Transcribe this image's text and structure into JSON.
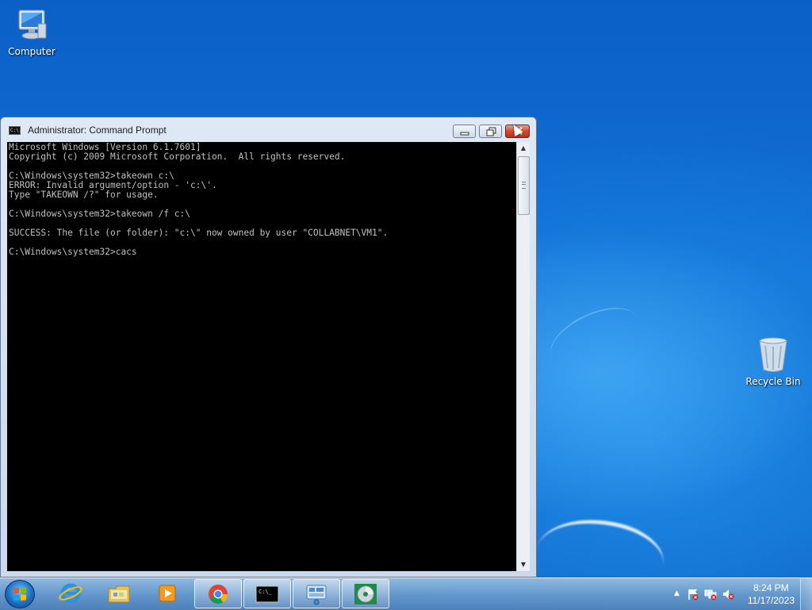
{
  "desktop": {
    "icons": [
      {
        "label": "Computer",
        "icon": "computer-icon"
      },
      {
        "label": "Recycle Bin",
        "icon": "recycle-bin-icon"
      }
    ]
  },
  "window": {
    "title": "Administrator: Command Prompt",
    "icon": "cmd-icon",
    "title_icon_text": "C:\\.",
    "controls": {
      "minimize": "minimize-icon",
      "maximize": "restore-icon",
      "close": "close-icon"
    },
    "console_lines": [
      "Microsoft Windows [Version 6.1.7601]",
      "Copyright (c) 2009 Microsoft Corporation.  All rights reserved.",
      "",
      "C:\\Windows\\system32>takeown c:\\",
      "ERROR: Invalid argument/option - 'c:\\'.",
      "Type \"TAKEOWN /?\" for usage.",
      "",
      "C:\\Windows\\system32>takeown /f c:\\",
      "",
      "SUCCESS: The file (or folder): \"c:\\\" now owned by user \"COLLABNET\\VM1\".",
      "",
      "C:\\Windows\\system32>cacs"
    ]
  },
  "taskbar": {
    "start": "windows-start-icon",
    "pinned": [
      {
        "name": "internet-explorer",
        "icon": "internet-explorer-icon",
        "active": false
      },
      {
        "name": "windows-explorer",
        "icon": "folder-icon",
        "active": false
      },
      {
        "name": "media-player",
        "icon": "media-player-icon",
        "active": false
      },
      {
        "name": "chrome",
        "icon": "chrome-icon",
        "active": true
      },
      {
        "name": "command-prompt",
        "icon": "cmd-icon",
        "active": true
      },
      {
        "name": "remote-desktop",
        "icon": "remote-desktop-icon",
        "active": true
      },
      {
        "name": "disc-app",
        "icon": "disc-icon",
        "active": true
      }
    ],
    "cmd_icon_text": "C:\\_",
    "tray": {
      "icons": [
        "show-hidden-icons-arrow",
        "action-center-flag-icon",
        "network-icon",
        "volume-muted-icon"
      ],
      "time": "8:24 PM",
      "date": "11/17/2023"
    }
  },
  "colors": {
    "console_bg": "#000000",
    "console_text": "#C0C0C0",
    "close_button": "#C94228",
    "desktop_blue": "#1272D6"
  }
}
